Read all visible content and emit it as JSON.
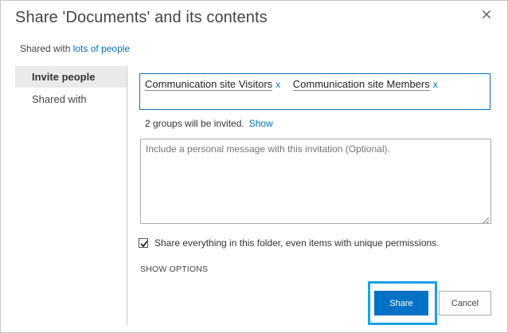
{
  "dialog": {
    "title": "Share 'Documents' and its contents",
    "close_icon": "close-icon"
  },
  "shared_with": {
    "prefix": "Shared with",
    "link": "lots of people"
  },
  "sidebar": {
    "items": [
      {
        "label": "Invite people",
        "active": true
      },
      {
        "label": "Shared with",
        "active": false
      }
    ]
  },
  "people_picker": {
    "tokens": [
      {
        "name": "Communication site Visitors",
        "remove": "x"
      },
      {
        "name": "Communication site Members",
        "remove": "x"
      }
    ]
  },
  "invite_status": {
    "text": "2 groups will be invited.",
    "show_link": "Show"
  },
  "message": {
    "placeholder": "Include a personal message with this invitation (Optional).",
    "value": ""
  },
  "share_everything": {
    "checked": true,
    "label": "Share everything in this folder, even items with unique permissions."
  },
  "options": {
    "show_options": "SHOW OPTIONS"
  },
  "buttons": {
    "share": "Share",
    "cancel": "Cancel"
  },
  "colors": {
    "accent": "#0072c6",
    "highlight": "#1ba1e2",
    "nav_active_bg": "#eaeaea"
  }
}
